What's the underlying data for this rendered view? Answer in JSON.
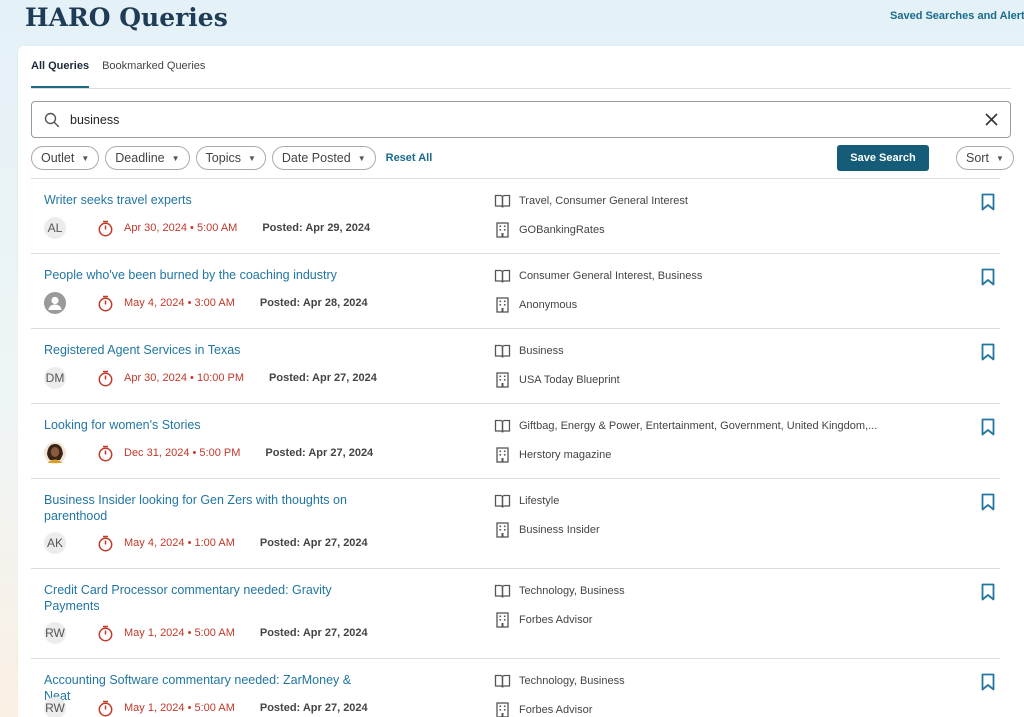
{
  "header": {
    "title": "HARO Queries",
    "saved_link": "Saved Searches and Alerts"
  },
  "tabs": [
    {
      "label": "All Queries",
      "active": true
    },
    {
      "label": "Bookmarked Queries",
      "active": false
    }
  ],
  "search": {
    "value": "business",
    "placeholder": ""
  },
  "filters": {
    "outlet": "Outlet",
    "deadline": "Deadline",
    "topics": "Topics",
    "date_posted": "Date Posted",
    "reset": "Reset All",
    "save_search": "Save Search",
    "sort": "Sort"
  },
  "colors": {
    "accent": "#155c78",
    "link": "#2276a2",
    "deadline": "#c0392b",
    "title": "#1e3c55"
  },
  "queries": [
    {
      "title": "Writer seeks travel experts",
      "avatar": "AL",
      "deadline": "Apr 30, 2024 • 5:00 AM",
      "posted": "Posted: Apr 29, 2024",
      "topics": "Travel, Consumer General Interest",
      "outlet": "GOBankingRates"
    },
    {
      "title": "People who've been burned by the coaching industry",
      "avatar": "",
      "avatar_icon": "person-icon",
      "deadline": "May 4, 2024 • 3:00 AM",
      "posted": "Posted: Apr 28, 2024",
      "topics": "Consumer General Interest, Business",
      "outlet": "Anonymous"
    },
    {
      "title": "Registered Agent Services in Texas",
      "avatar": "DM",
      "deadline": "Apr 30, 2024 • 10:00 PM",
      "posted": "Posted: Apr 27, 2024",
      "topics": "Business",
      "outlet": "USA Today Blueprint"
    },
    {
      "title": "Looking for women's Stories",
      "avatar": "",
      "avatar_icon": "photo-avatar",
      "deadline": "Dec 31, 2024 • 5:00 PM",
      "posted": "Posted: Apr 27, 2024",
      "topics": "Giftbag, Energy & Power, Entertainment, Government, United Kingdom,...",
      "outlet": "Herstory magazine"
    },
    {
      "title": "Business Insider looking for Gen Zers with thoughts on parenthood",
      "avatar": "AK",
      "deadline": "May 4, 2024 • 1:00 AM",
      "posted": "Posted: Apr 27, 2024",
      "topics": "Lifestyle",
      "outlet": "Business Insider"
    },
    {
      "title": "Credit Card Processor commentary needed: Gravity Payments",
      "avatar": "RW",
      "deadline": "May 1, 2024 • 5:00 AM",
      "posted": "Posted: Apr 27, 2024",
      "topics": "Technology, Business",
      "outlet": "Forbes Advisor"
    },
    {
      "title": "Accounting Software commentary needed: ZarMoney & Neat",
      "avatar": "RW",
      "deadline": "May 1, 2024 • 5:00 AM",
      "posted": "Posted: Apr 27, 2024",
      "topics": "Technology, Business",
      "outlet": "Forbes Advisor"
    }
  ]
}
